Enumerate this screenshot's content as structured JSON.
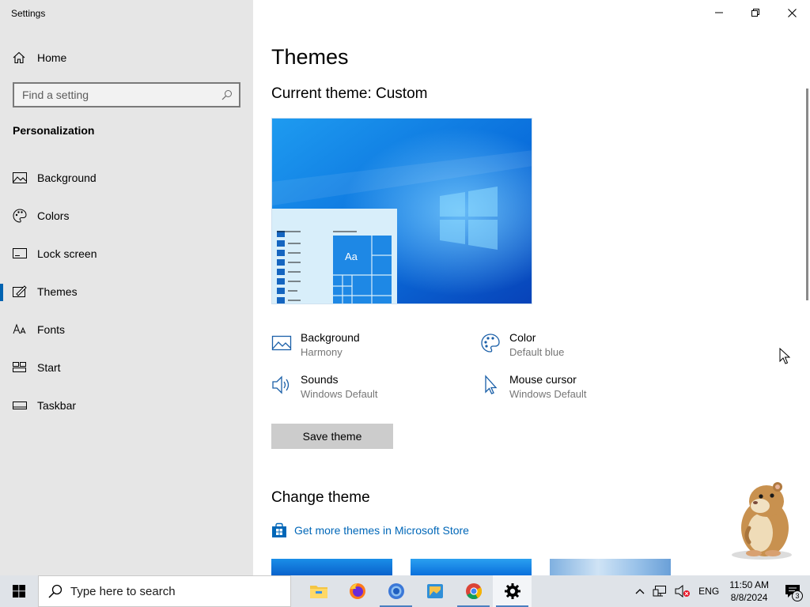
{
  "window": {
    "app_title": "Settings",
    "controls": [
      "minimize",
      "restore",
      "close"
    ]
  },
  "sidebar": {
    "home_label": "Home",
    "search_placeholder": "Find a setting",
    "section_title": "Personalization",
    "items": [
      {
        "label": "Background",
        "icon": "image-icon"
      },
      {
        "label": "Colors",
        "icon": "palette-icon"
      },
      {
        "label": "Lock screen",
        "icon": "lock-screen-icon"
      },
      {
        "label": "Themes",
        "icon": "themes-icon",
        "active": true
      },
      {
        "label": "Fonts",
        "icon": "fonts-icon"
      },
      {
        "label": "Start",
        "icon": "start-icon"
      },
      {
        "label": "Taskbar",
        "icon": "taskbar-icon"
      }
    ]
  },
  "main": {
    "title": "Themes",
    "current_theme": "Current theme: Custom",
    "preview_tile_text": "Aa",
    "properties": {
      "background": {
        "label": "Background",
        "value": "Harmony"
      },
      "color": {
        "label": "Color",
        "value": "Default blue"
      },
      "sounds": {
        "label": "Sounds",
        "value": "Windows Default"
      },
      "mouse_cursor": {
        "label": "Mouse cursor",
        "value": "Windows Default"
      }
    },
    "save_button": "Save theme",
    "change_theme_title": "Change theme",
    "store_link": "Get more themes in Microsoft Store"
  },
  "taskbar": {
    "search_placeholder": "Type here to search",
    "apps": [
      "file-explorer-icon",
      "firefox-icon",
      "chrome-remote-icon",
      "photos-icon",
      "chrome-icon",
      "settings-icon"
    ],
    "language": "ENG",
    "time": "11:50 AM",
    "date": "8/8/2024",
    "notification_count": "3"
  },
  "colors": {
    "accent": "#0063b1",
    "link": "#0067b8",
    "sidebar_bg": "#e6e6e6",
    "taskbar_bg": "#dfe3e8"
  }
}
